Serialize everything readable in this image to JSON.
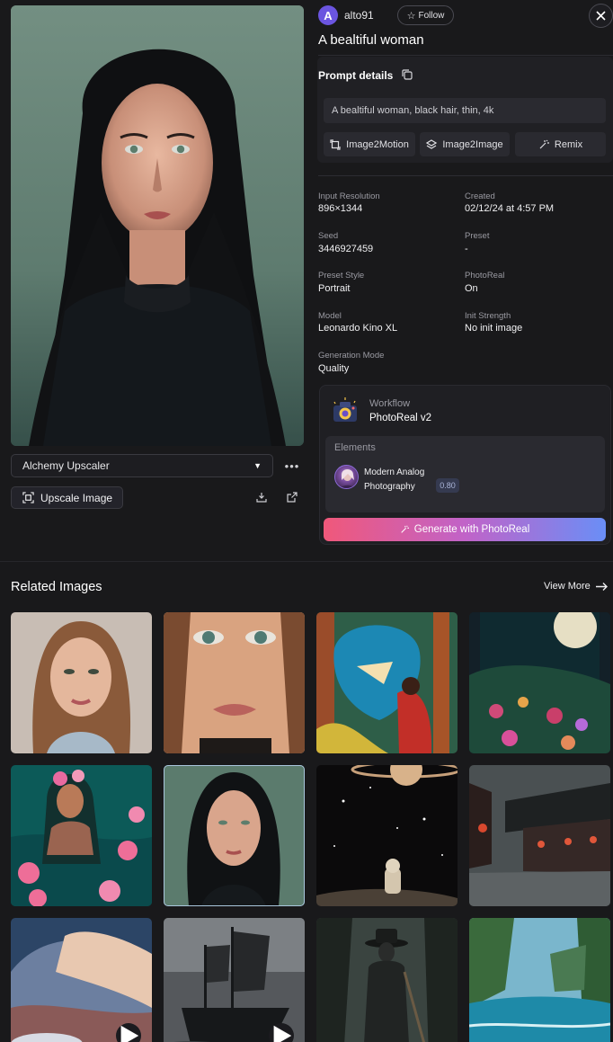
{
  "user": {
    "avatar_letter": "A",
    "username": "alto91",
    "follow_label": "Follow"
  },
  "image": {
    "title": "A bealtiful woman"
  },
  "prompt": {
    "label": "Prompt details",
    "text": "A bealtiful woman, black hair, thin, 4k",
    "actions": [
      "Image2Motion",
      "Image2Image",
      "Remix"
    ]
  },
  "details": [
    {
      "label": "Input Resolution",
      "value": "896×1344"
    },
    {
      "label": "Created",
      "value": "02/12/24 at 4:57 PM"
    },
    {
      "label": "Seed",
      "value": "3446927459"
    },
    {
      "label": "Preset",
      "value": "-"
    },
    {
      "label": "Preset Style",
      "value": "Portrait"
    },
    {
      "label": "PhotoReal",
      "value": "On"
    },
    {
      "label": "Model",
      "value": "Leonardo Kino XL"
    },
    {
      "label": "Init Strength",
      "value": "No init image"
    },
    {
      "label": "Generation Mode",
      "value": "Quality"
    }
  ],
  "workflow": {
    "label": "Workflow",
    "value": "PhotoReal v2",
    "elements_label": "Elements",
    "element_name": "Modern Analog Photography",
    "element_strength": "0.80",
    "generate_label": "Generate with PhotoReal"
  },
  "upscaler": {
    "selected": "Alchemy Upscaler",
    "upscale_label": "Upscale Image"
  },
  "related": {
    "title": "Related Images",
    "view_more": "View More",
    "selected_index": 5,
    "video_indices": [
      8,
      9
    ]
  },
  "colors": {
    "background": "#19191b",
    "panel": "#202024",
    "accent_avatar": "#6b55e0",
    "generate_gradient": [
      "#f0587a",
      "#c163c8",
      "#6a8ef6"
    ]
  }
}
